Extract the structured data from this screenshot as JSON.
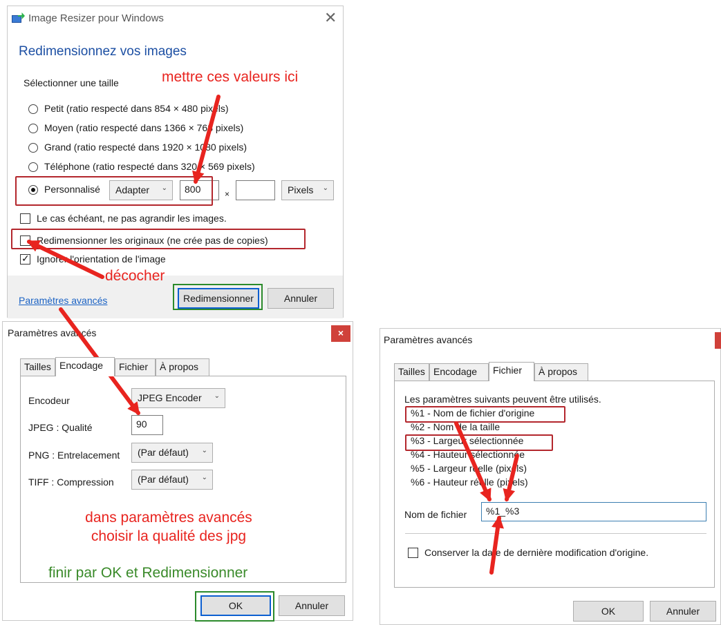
{
  "window1": {
    "title": "Image Resizer pour Windows",
    "heading": "Redimensionnez vos images",
    "size_label": "Sélectionner une taille",
    "sizes": [
      {
        "label": "Petit (ratio respecté dans 854 × 480 pixels)",
        "checked": false
      },
      {
        "label": "Moyen (ratio respecté dans 1366 × 768 pixels)",
        "checked": false
      },
      {
        "label": "Grand (ratio respecté dans 1920 × 1080 pixels)",
        "checked": false
      },
      {
        "label": "Téléphone (ratio respecté dans 320 × 569 pixels)",
        "checked": false
      },
      {
        "label": "Personnalisé",
        "checked": true
      }
    ],
    "custom": {
      "mode": "Adapter",
      "width": "800",
      "height": "",
      "times": "×",
      "unit": "Pixels"
    },
    "options": [
      {
        "label": "Le cas échéant, ne pas agrandir les images.",
        "checked": false
      },
      {
        "label": "Redimensionner les originaux (ne crée pas de copies)",
        "checked": false
      },
      {
        "label": "Ignorer l'orientation de l'image",
        "checked": true
      }
    ],
    "advanced_link": "Paramètres avancés",
    "resize_button": "Redimensionner",
    "cancel_button": "Annuler"
  },
  "window2": {
    "title": "Paramètres avancés",
    "tabs": [
      "Tailles",
      "Encodage",
      "Fichier",
      "À propos"
    ],
    "active_tab": "Encodage",
    "fields": {
      "encoder_label": "Encodeur",
      "encoder_value": "JPEG Encoder",
      "quality_label": "JPEG : Qualité",
      "quality_value": "90",
      "png_label": "PNG : Entrelacement",
      "png_value": "(Par défaut)",
      "tiff_label": "TIFF : Compression",
      "tiff_value": "(Par défaut)"
    },
    "ok_button": "OK",
    "cancel_button": "Annuler"
  },
  "window3": {
    "title": "Paramètres avancés",
    "tabs": [
      "Tailles",
      "Encodage",
      "Fichier",
      "À propos"
    ],
    "active_tab": "Fichier",
    "intro": "Les paramètres suivants peuvent être utilisés.",
    "params": [
      "%1 - Nom de fichier d'origine",
      "%2 - Nom de la taille",
      "%3 - Largeur sélectionnée",
      "%4 - Hauteur sélectionnée",
      "%5 - Largeur réelle (pixels)",
      "%6 - Hauteur réelle (pixels)"
    ],
    "filename_label": "Nom de fichier",
    "filename_value": "%1_%3",
    "keep_date_label": "Conserver la date de dernière modification d'origine.",
    "keep_date_checked": false,
    "ok_button": "OK",
    "cancel_button": "Annuler"
  },
  "annotations": {
    "put_values": "mettre ces valeurs ici",
    "uncheck": "décocher",
    "advanced_line1": "dans paramètres avancés",
    "advanced_line2": "choisir la qualité des jpg",
    "finish": "finir par OK et Redimensionner"
  },
  "colors": {
    "annotation_red": "#e8241f",
    "annotation_green": "#3a8a2a",
    "heading_blue": "#1c4fa3",
    "link_blue": "#1a62c4",
    "close_red": "#d0413a"
  }
}
